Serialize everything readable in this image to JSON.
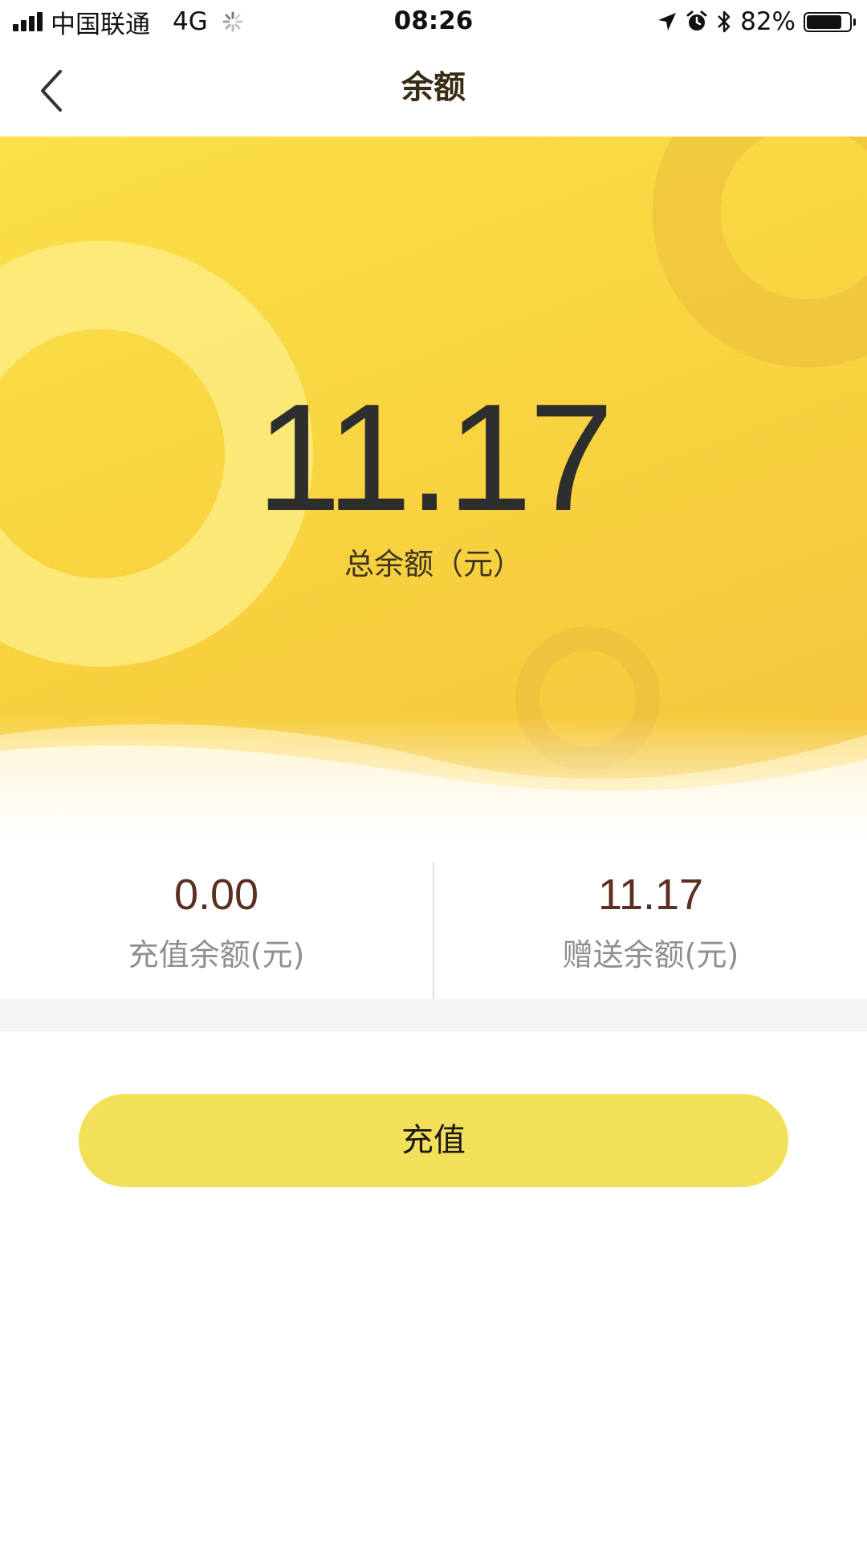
{
  "status_bar": {
    "carrier": "中国联通",
    "network": "4G",
    "time": "08:26",
    "battery_percent": "82%",
    "battery_level": 0.82,
    "icons": [
      "signal-icon",
      "loading-spinner-icon",
      "location-arrow-icon",
      "alarm-icon",
      "bluetooth-icon",
      "battery-icon"
    ]
  },
  "nav": {
    "title": "余额",
    "back_icon": "chevron-left-icon"
  },
  "balance": {
    "total_amount": "11.17",
    "total_label": "总余额（元）"
  },
  "breakdown": {
    "recharge": {
      "value": "0.00",
      "label": "充值余额(元)"
    },
    "gift": {
      "value": "11.17",
      "label": "赠送余额(元)"
    }
  },
  "actions": {
    "recharge_label": "充值"
  },
  "colors": {
    "hero_top": "#fbe048",
    "hero_bottom": "#f5c33a",
    "button": "#f3e05a",
    "amount_text": "#2e2e2e",
    "split_value_text": "#5b2f22",
    "split_label_text": "#8f8f8f"
  }
}
